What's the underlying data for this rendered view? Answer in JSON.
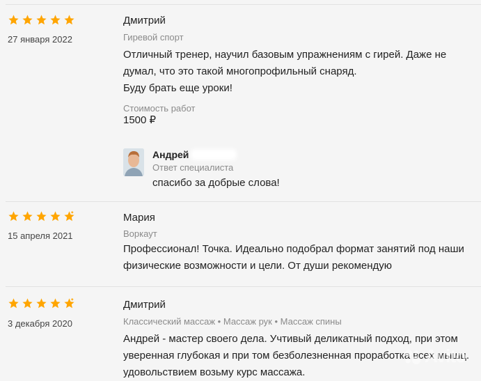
{
  "reviews": [
    {
      "rating": 5,
      "date": "27 января 2022",
      "author": "Дмитрий",
      "category": "Гиревой спорт",
      "text_lines": [
        "Отличный тренер, научил базовым упражнениям с гирей. Даже не",
        "думал, что это такой многопрофильный снаряд.",
        "Буду брать еще уроки!"
      ],
      "price_label": "Стоимость работ",
      "price_value": "1500 ₽",
      "reply": {
        "name": "Андрей",
        "label": "Ответ специалиста",
        "text": "спасибо за добрые слова!"
      }
    },
    {
      "rating": 4.5,
      "date": "15 апреля 2021",
      "author": "Мария",
      "category": "Воркаут",
      "text_lines": [
        "Профессионал! Точка. Идеально подобрал формат занятий под наши",
        "физические возможности и цели. От души рекомендую"
      ]
    },
    {
      "rating": 4.5,
      "date": "3 декабря 2020",
      "author": "Дмитрий",
      "category": "Классический массаж • Массаж рук • Массаж спины",
      "text_lines": [
        "Андрей - мастер своего дела. Учтивый деликатный подход, при этом",
        "уверенная глубокая и при том безболезненная проработка всех мышц.",
        "удовольствием возьму курс массажа."
      ]
    }
  ],
  "watermark": "Avito",
  "colors": {
    "star": "#ffa500",
    "muted": "#8a8a8a",
    "text": "#222222",
    "background": "#f5f5f5"
  }
}
